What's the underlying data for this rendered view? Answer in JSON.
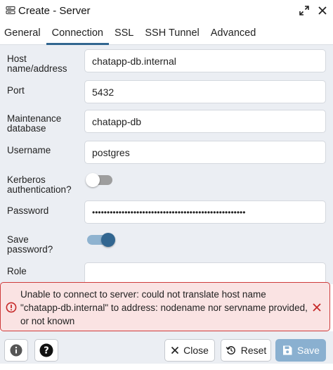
{
  "window": {
    "title": "Create - Server",
    "icons": [
      "server-icon",
      "expand-icon",
      "close-icon"
    ]
  },
  "tabs": [
    {
      "label": "General",
      "active": false
    },
    {
      "label": "Connection",
      "active": true
    },
    {
      "label": "SSL",
      "active": false
    },
    {
      "label": "SSH Tunnel",
      "active": false
    },
    {
      "label": "Advanced",
      "active": false
    }
  ],
  "form": {
    "host": {
      "label_line1": "Host",
      "label_line2": "name/address",
      "value": "chatapp-db.internal"
    },
    "port": {
      "label": "Port",
      "value": "5432"
    },
    "maintenance_db": {
      "label_line1": "Maintenance",
      "label_line2": "database",
      "value": "chatapp-db"
    },
    "username": {
      "label": "Username",
      "value": "postgres"
    },
    "kerberos": {
      "label_line1": "Kerberos",
      "label_line2": "authentication?",
      "enabled": false
    },
    "password": {
      "label": "Password",
      "value": "••••••••••••••••••••••••••••••••••••••••••••••••••••"
    },
    "save_password": {
      "label_line1": "Save",
      "label_line2": "password?",
      "enabled": true
    },
    "role": {
      "label": "Role",
      "value": ""
    }
  },
  "error": {
    "message": "Unable to connect to server: could not translate host name \"chatapp-db.internal\" to address: nodename nor servname provided, or not known",
    "color": "#ce3b3b"
  },
  "footer": {
    "info_icon": "info-icon",
    "help_icon": "help-icon",
    "close_label": "Close",
    "reset_label": "Reset",
    "save_label": "Save"
  },
  "colors": {
    "accent": "#326690",
    "error_border": "#ce3b3b",
    "error_bg": "#fae3e3",
    "panel_bg": "#ebeef3"
  }
}
